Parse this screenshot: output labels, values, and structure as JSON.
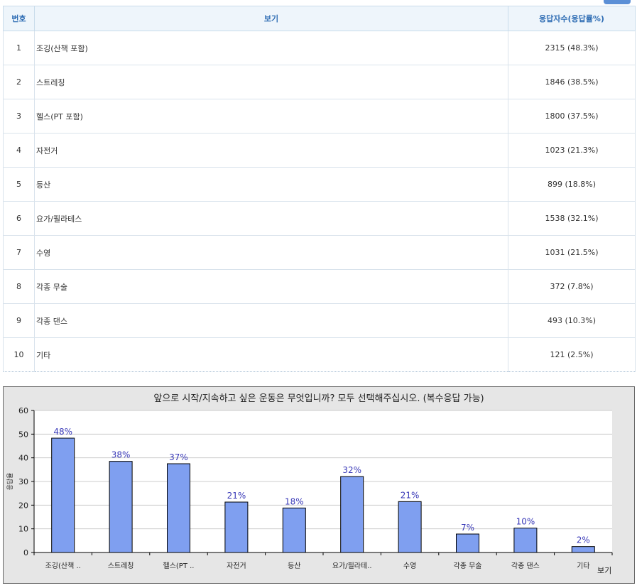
{
  "table": {
    "headers": {
      "num": "번호",
      "option": "보기",
      "count": "응답자수(응답률%)"
    },
    "rows": [
      {
        "num": "1",
        "option": "조깅(산책 포함)",
        "count": "2315 (48.3%)"
      },
      {
        "num": "2",
        "option": "스트레칭",
        "count": "1846 (38.5%)"
      },
      {
        "num": "3",
        "option": "헬스(PT 포함)",
        "count": "1800 (37.5%)"
      },
      {
        "num": "4",
        "option": "자전거",
        "count": "1023 (21.3%)"
      },
      {
        "num": "5",
        "option": "등산",
        "count": "899 (18.8%)"
      },
      {
        "num": "6",
        "option": "요가/필라테스",
        "count": "1538 (32.1%)"
      },
      {
        "num": "7",
        "option": "수영",
        "count": "1031 (21.5%)"
      },
      {
        "num": "8",
        "option": "각종 무술",
        "count": "372 (7.8%)"
      },
      {
        "num": "9",
        "option": "각종 댄스",
        "count": "493 (10.3%)"
      },
      {
        "num": "10",
        "option": "기타",
        "count": "121 (2.5%)"
      }
    ]
  },
  "chart_data": {
    "type": "bar",
    "title": "앞으로 시작/지속하고 싶은 운동은 무엇입니까? 모두 선택해주십시오. (복수응답 가능)",
    "xlabel": "보기",
    "ylabel": "응답율",
    "ylim": [
      0,
      60
    ],
    "yticks": [
      0,
      10,
      20,
      30,
      40,
      50,
      60
    ],
    "categories": [
      "조깅(산책 ..",
      "스트레칭",
      "헬스(PT ..",
      "자전거",
      "등산",
      "요가/필라테..",
      "수영",
      "각종 무술",
      "각종 댄스",
      "기타"
    ],
    "values": [
      48.3,
      38.5,
      37.5,
      21.3,
      18.8,
      32.1,
      21.5,
      7.8,
      10.3,
      2.5
    ],
    "data_labels": [
      "48%",
      "38%",
      "37%",
      "21%",
      "18%",
      "32%",
      "21%",
      "7%",
      "10%",
      "2%"
    ],
    "bar_color": "#7f9ff0",
    "grid": true,
    "legend": "none"
  }
}
